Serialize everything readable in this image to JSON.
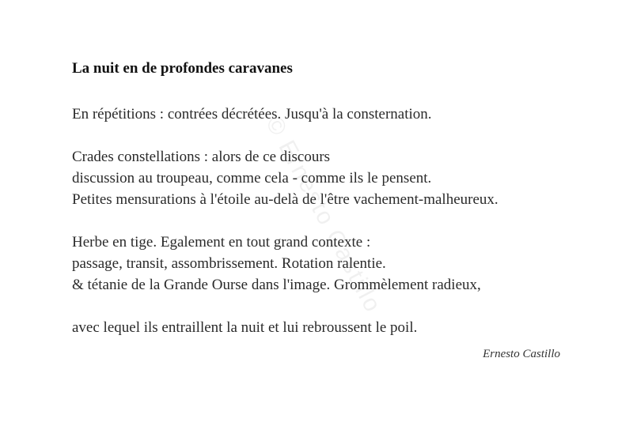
{
  "poem": {
    "title": "La nuit en de profondes caravanes",
    "stanza1": {
      "line1": "En répétitions : contrées décrétées. Jusqu'à la consternation."
    },
    "stanza2": {
      "line1": "Crades constellations : alors de ce discours",
      "line2": "discussion au troupeau, comme cela - comme ils le pensent.",
      "line3": "Petites mensurations à l'étoile au-delà de l'être vachement-malheureux."
    },
    "stanza3": {
      "line1": "Herbe en tige. Egalement en tout grand contexte :",
      "line2": "passage, transit, assombrissement. Rotation ralentie.",
      "line3": "& tétanie de la Grande Ourse dans l'image. Grommèlement radieux,"
    },
    "stanza4": {
      "line1": "avec lequel ils entraillent la nuit et lui rebroussent le poil."
    },
    "author": "Ernesto Castillo"
  },
  "watermark": {
    "text": "© Ernesto Castillo"
  }
}
